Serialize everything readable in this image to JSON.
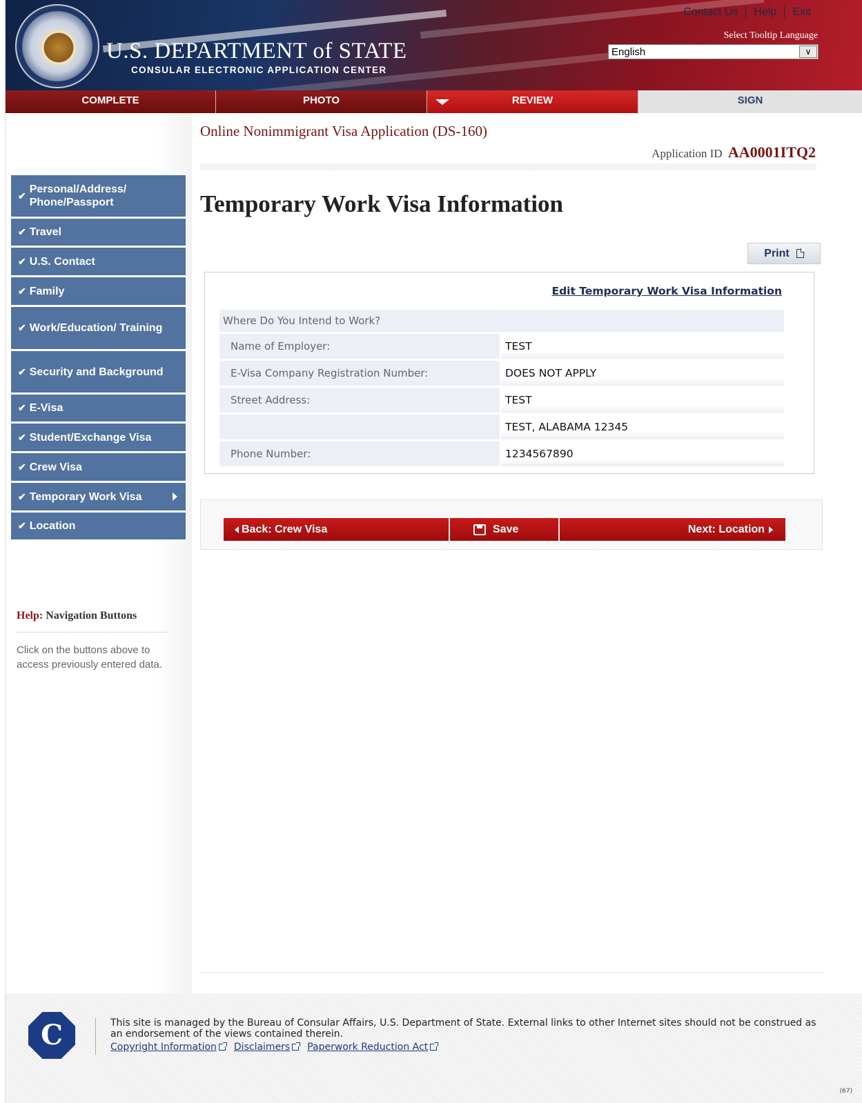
{
  "header": {
    "dept_title": "U.S. DEPARTMENT of STATE",
    "dept_subtitle": "CONSULAR ELECTRONIC APPLICATION CENTER",
    "links": {
      "contact": "Contact Us",
      "help": "Help",
      "exit": "Exit"
    },
    "tooltip_language_label": "Select Tooltip Language",
    "tooltip_language_value": "English"
  },
  "steps": [
    {
      "label": "COMPLETE",
      "state": "done"
    },
    {
      "label": "PHOTO",
      "state": "done"
    },
    {
      "label": "REVIEW",
      "state": "current"
    },
    {
      "label": "SIGN",
      "state": "todo"
    }
  ],
  "sidebar": {
    "items": [
      {
        "label": "Personal/Address/ Phone/Passport"
      },
      {
        "label": "Travel"
      },
      {
        "label": "U.S. Contact"
      },
      {
        "label": "Family"
      },
      {
        "label": "Work/Education/ Training"
      },
      {
        "label": "Security and Background"
      },
      {
        "label": "E-Visa"
      },
      {
        "label": "Student/Exchange Visa"
      },
      {
        "label": "Crew Visa"
      },
      {
        "label": "Temporary Work Visa"
      },
      {
        "label": "Location"
      }
    ],
    "help": {
      "title_prefix": "Help:",
      "title": "Navigation Buttons",
      "text": "Click on the buttons above to access previously entered data."
    }
  },
  "main": {
    "form_name": "Online Nonimmigrant Visa Application (DS-160)",
    "application_id_label": "Application ID",
    "application_id": "AA0001ITQ2",
    "page_title": "Temporary Work Visa Information",
    "print_label": "Print",
    "edit_link": "Edit Temporary Work Visa Information",
    "section_heading": "Where Do You Intend to Work?",
    "rows": [
      {
        "label": "Name of Employer:",
        "value": "TEST"
      },
      {
        "label": "E-Visa Company Registration Number:",
        "value": "DOES NOT APPLY"
      },
      {
        "label": "Street Address:",
        "value": "TEST"
      },
      {
        "label": "",
        "value": "TEST, ALABAMA 12345"
      },
      {
        "label": "Phone Number:",
        "value": "1234567890"
      }
    ],
    "nav": {
      "back": "Back: Crew Visa",
      "save": "Save",
      "next": "Next: Location"
    }
  },
  "footer": {
    "text": "This site is managed by the Bureau of Consular Affairs, U.S. Department of State. External links to other Internet sites should not be construed as an endorsement of the views contained therein.",
    "links": [
      "Copyright Information",
      "Disclaimers",
      "Paperwork Reduction Act"
    ],
    "version": "(67)"
  },
  "colors": {
    "nav_blue": "#52729f",
    "brand_red": "#7a1414",
    "button_red": "#b21111"
  }
}
